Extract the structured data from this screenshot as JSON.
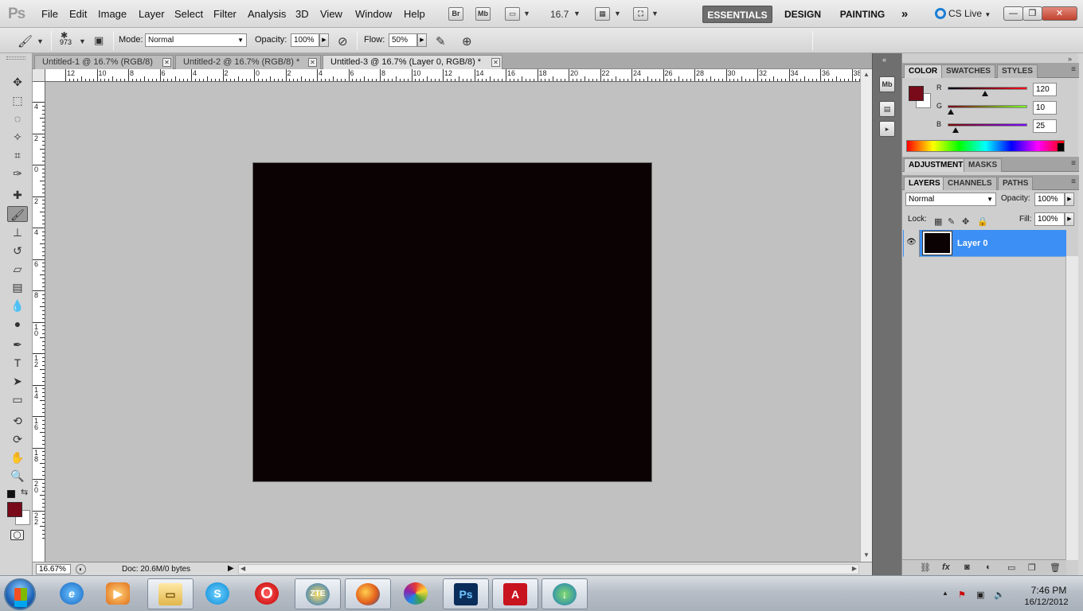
{
  "app": {
    "logo": "Ps",
    "menu": [
      "File",
      "Edit",
      "Image",
      "Layer",
      "Select",
      "Filter",
      "Analysis",
      "3D",
      "View",
      "Window",
      "Help"
    ],
    "launchers": [
      "Br",
      "Mb"
    ],
    "zoom": "16.7",
    "workspaces": [
      "ESSENTIALS",
      "DESIGN",
      "PAINTING"
    ],
    "workspace_more": "»",
    "cs_live": "CS Live"
  },
  "options": {
    "brush_size": "973",
    "mode_label": "Mode:",
    "mode_value": "Normal",
    "opacity_label": "Opacity:",
    "opacity_value": "100%",
    "flow_label": "Flow:",
    "flow_value": "50%"
  },
  "tools": {
    "active": "brush-tool",
    "foreground_color": "#780a19",
    "background_color": "#ffffff"
  },
  "documents": {
    "tabs": [
      {
        "title": "Untitled-1 @ 16.7% (RGB/8)"
      },
      {
        "title": "Untitled-2 @ 16.7% (RGB/8) *"
      },
      {
        "title": "Untitled-3 @ 16.7% (Layer 0, RGB/8) *"
      }
    ],
    "active_tab": 2,
    "canvas_fill": "#0b0203",
    "ruler_top_labels": [
      "12",
      "10",
      "8",
      "6",
      "4",
      "2",
      "0",
      "2",
      "4",
      "6",
      "8",
      "10",
      "12",
      "14",
      "16",
      "18",
      "20",
      "22",
      "24",
      "26",
      "28",
      "30",
      "32",
      "34",
      "36",
      "38"
    ],
    "ruler_left_labels": [
      "4",
      "2",
      "0",
      "2",
      "4",
      "6",
      "8",
      "10",
      "12",
      "14",
      "16",
      "18",
      "20",
      "22"
    ]
  },
  "status": {
    "zoom": "16.67%",
    "doc_info": "Doc: 20.6M/0 bytes"
  },
  "panels": {
    "color_tabs": [
      "COLOR",
      "SWATCHES",
      "STYLES"
    ],
    "channels": [
      {
        "label": "R",
        "value": "120",
        "level": 0.47
      },
      {
        "label": "G",
        "value": "10",
        "level": 0.04
      },
      {
        "label": "B",
        "value": "25",
        "level": 0.1
      }
    ],
    "adjustment_tabs": [
      "ADJUSTMENTS",
      "MASKS"
    ],
    "layer_tabs": [
      "LAYERS",
      "CHANNELS",
      "PATHS"
    ],
    "blend_mode": "Normal",
    "opacity_label": "Opacity:",
    "opacity_value": "100%",
    "lock_label": "Lock:",
    "fill_label": "Fill:",
    "fill_value": "100%",
    "layers": [
      {
        "name": "Layer 0",
        "selected": true,
        "visible": true
      }
    ],
    "footer_icons": [
      "link-icon",
      "fx-icon",
      "mask-icon",
      "adjustment-icon",
      "group-icon",
      "new-layer-icon",
      "trash-icon"
    ]
  },
  "taskbar": {
    "apps": [
      "Internet Explorer",
      "Windows Media Player",
      "Windows Explorer",
      "Skype",
      "Opera",
      "ZTE",
      "Firefox",
      "Picasa",
      "Photoshop",
      "Adobe Reader",
      "Internet Download Manager"
    ],
    "running_apps": [
      "Windows Explorer",
      "ZTE",
      "Firefox",
      "Photoshop",
      "Adobe Reader",
      "Internet Download Manager"
    ],
    "time": "7:46 PM",
    "date": "16/12/2012"
  }
}
